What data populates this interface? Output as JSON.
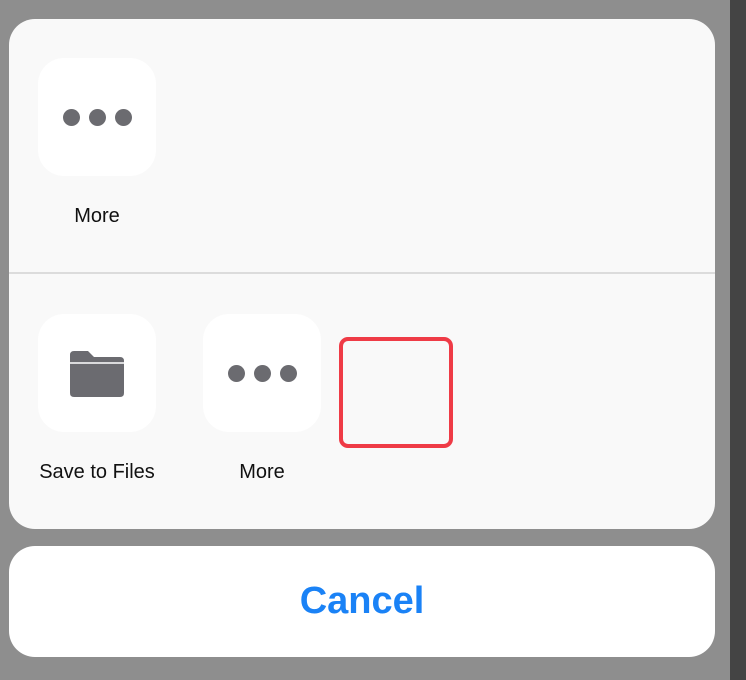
{
  "share_sheet": {
    "top_row": [
      {
        "label": "More",
        "icon": "more-icon"
      }
    ],
    "bottom_row": [
      {
        "label": "Save to Files",
        "icon": "folder-icon"
      },
      {
        "label": "More",
        "icon": "more-icon"
      }
    ]
  },
  "cancel": {
    "label": "Cancel"
  },
  "colors": {
    "accent": "#1a82f6",
    "icon_gray": "#6b6b70",
    "highlight": "#ef3b46",
    "backdrop": "#8e8e8e"
  }
}
